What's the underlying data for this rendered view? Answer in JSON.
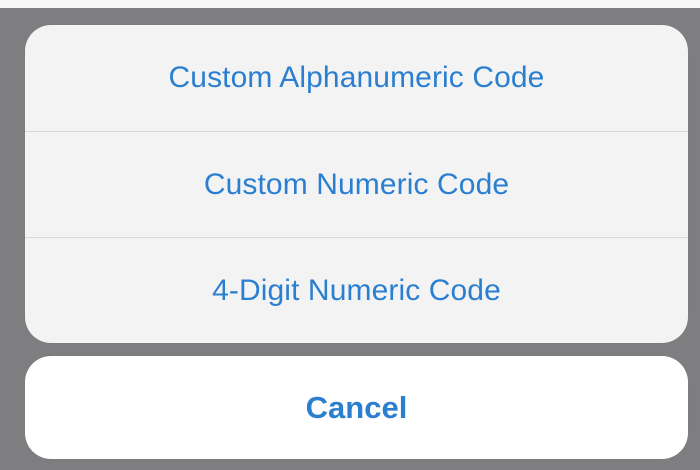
{
  "action_sheet": {
    "options": [
      {
        "label": "Custom Alphanumeric Code"
      },
      {
        "label": "Custom Numeric Code"
      },
      {
        "label": "4-Digit Numeric Code"
      }
    ],
    "cancel_label": "Cancel"
  },
  "colors": {
    "accent": "#2b7fd0",
    "dimmed_background": "#7e7e80",
    "sheet_background": "#f3f3f4",
    "cancel_background": "#ffffff",
    "separator": "#d8d8dc"
  }
}
